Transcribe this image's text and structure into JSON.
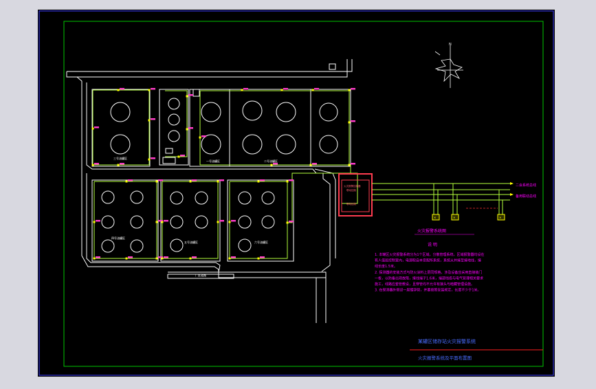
{
  "colors": {
    "canvas": "#000000",
    "outer_frame": "#3c3cff",
    "inner_frame": "#00c800",
    "outline": "#ffffff",
    "wiring": "#b4ff3c",
    "device": "#ffff00",
    "panel": "#ff3c50",
    "label_magenta": "#ff00ff",
    "label_blue": "#4a6cff",
    "title_line": "#ff2020"
  },
  "compass": {
    "north_label": "N"
  },
  "legend": {
    "bus_line_1": "二会系统总线",
    "bus_line_2": "备用联动总线"
  },
  "panel": {
    "line_1": "火灾报警控制器",
    "line_2": "联动控制"
  },
  "system_caption": "火灾报警系统图",
  "notes": {
    "heading": "说 明",
    "lines": [
      "1. 本罐区火灾报警系统分为1个区域，分散管理系统，区域报警器均设在",
      "有人值班控制室内，电源取自本变配所系统，系统从并接至接地线，接",
      "线长度1.5米。",
      "2. 探测器的安装方式与防火涂料上层同规格，涉及设备应采用直接装门",
      "一板，以防备出现故障，接线端子1.6米，端部线缆与电气管理相关要求",
      "施工，线路应套管敷设，且穿管均不允许有接头与暗藏管理设施。",
      "3. 在探测器外侧设一层镀锌管，并要按照安装规定，长度不少于1米。"
    ]
  },
  "tank_labels": [
    "三号油罐区",
    "一号油罐区",
    "二号油罐区",
    "四号油罐区",
    "五号油罐区",
    "六号油罐区"
  ],
  "road_label": "厂区道路",
  "title_block": {
    "project": "某罐区储存站火灾报警系统",
    "drawing": "火灾报警系统及平面布置图"
  }
}
